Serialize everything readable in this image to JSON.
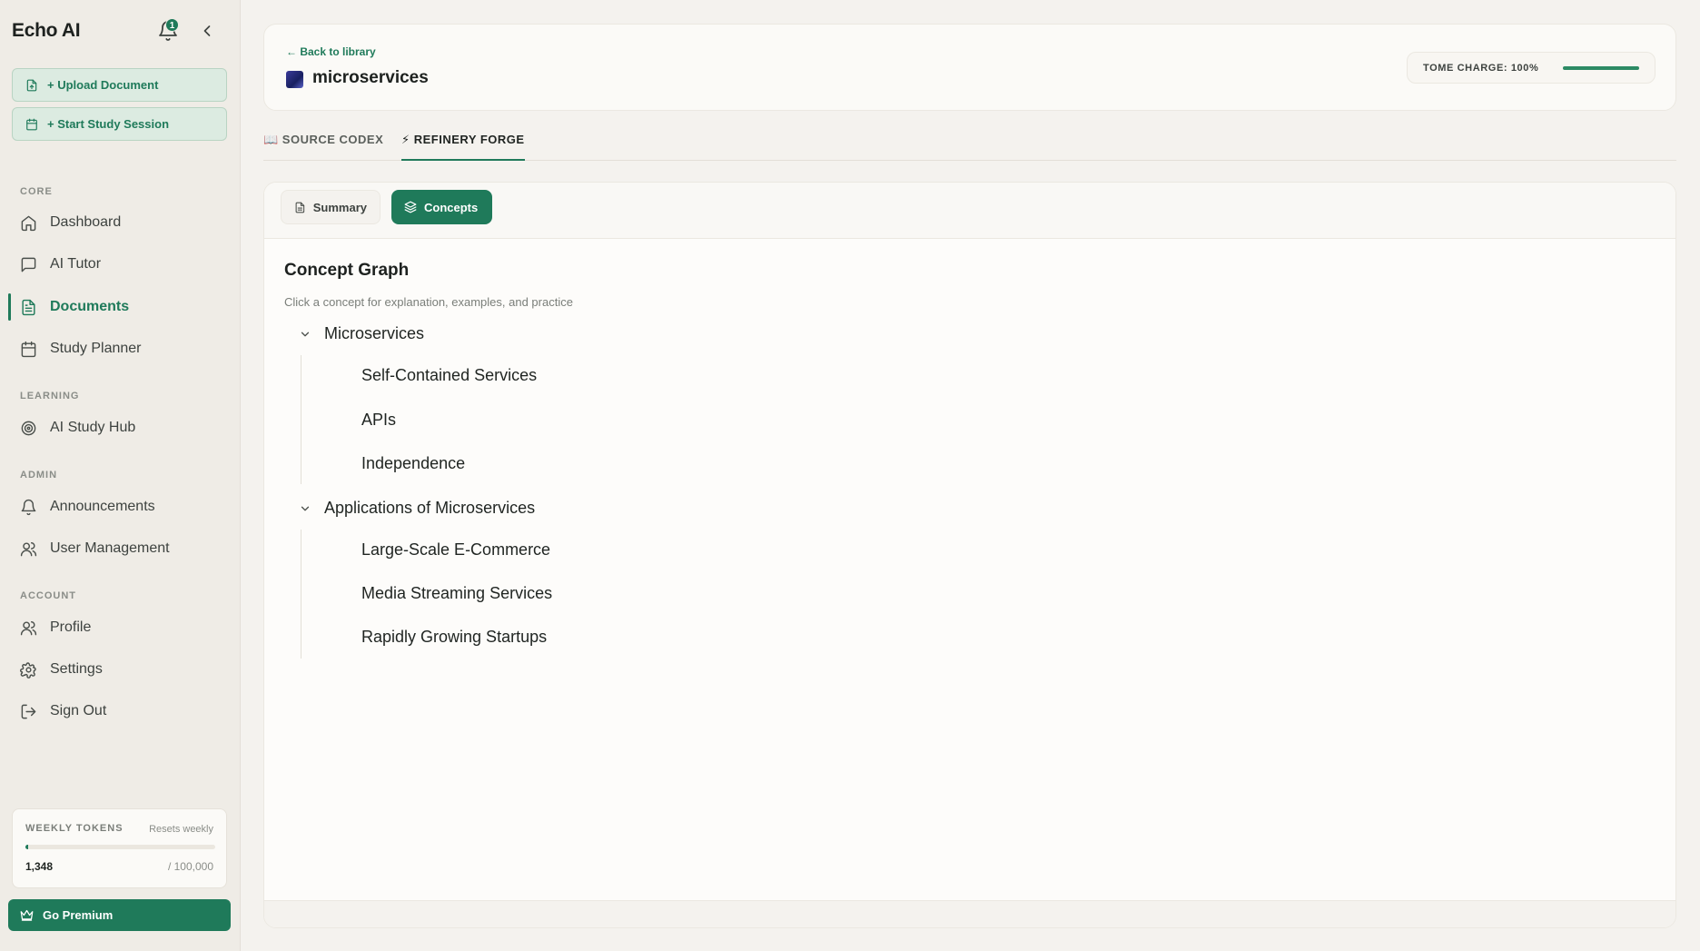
{
  "app": {
    "name": "Echo AI",
    "notification_count": "1"
  },
  "sidebar": {
    "actions": [
      {
        "label": "+ Upload Document",
        "icon": "upload-file-icon"
      },
      {
        "label": "+ Start Study Session",
        "icon": "calendar-icon"
      }
    ],
    "sections": {
      "core": "CORE",
      "learning": "LEARNING",
      "admin": "ADMIN",
      "account": "ACCOUNT"
    },
    "items": [
      {
        "label": "Dashboard",
        "icon": "home-icon",
        "active": false
      },
      {
        "label": "AI Tutor",
        "icon": "chat-icon",
        "active": false
      },
      {
        "label": "Documents",
        "icon": "document-icon",
        "active": true
      },
      {
        "label": "Study Planner",
        "icon": "calendar-icon",
        "active": false
      },
      {
        "label": "AI Study Hub",
        "icon": "target-icon",
        "active": false
      },
      {
        "label": "Announcements",
        "icon": "bell-icon",
        "active": false
      },
      {
        "label": "User Management",
        "icon": "users-icon",
        "active": false
      },
      {
        "label": "Profile",
        "icon": "users-icon",
        "active": false
      },
      {
        "label": "Settings",
        "icon": "gear-icon",
        "active": false
      },
      {
        "label": "Sign Out",
        "icon": "sign-out-icon",
        "active": false
      }
    ],
    "tokens": {
      "title": "WEEKLY TOKENS",
      "resets": "Resets weekly",
      "used": "1,348",
      "limit": "/ 100,000",
      "fraction": 0.01348
    },
    "premium_label": "Go Premium"
  },
  "header": {
    "back_label": "← Back to library",
    "doc_title": "microservices",
    "charge_label": "TOME CHARGE: 100%",
    "charge_fraction": 1.0
  },
  "tabs": [
    {
      "label": "📖 SOURCE CODEX",
      "active": false
    },
    {
      "label": "⚡ REFINERY FORGE",
      "active": true
    }
  ],
  "subtabs": {
    "summary": "Summary",
    "concepts": "Concepts"
  },
  "concept_graph": {
    "title": "Concept Graph",
    "subtitle": "Click a concept for explanation, examples, and practice",
    "groups": [
      {
        "label": "Microservices",
        "children": [
          "Self-Contained Services",
          "APIs",
          "Independence"
        ]
      },
      {
        "label": "Applications of Microservices",
        "children": [
          "Large-Scale E-Commerce",
          "Media Streaming Services",
          "Rapidly Growing Startups"
        ]
      }
    ]
  },
  "colors": {
    "accent": "#1f7a5a",
    "sidebar_bg": "#efece6",
    "page_bg": "#f4f2ee"
  }
}
